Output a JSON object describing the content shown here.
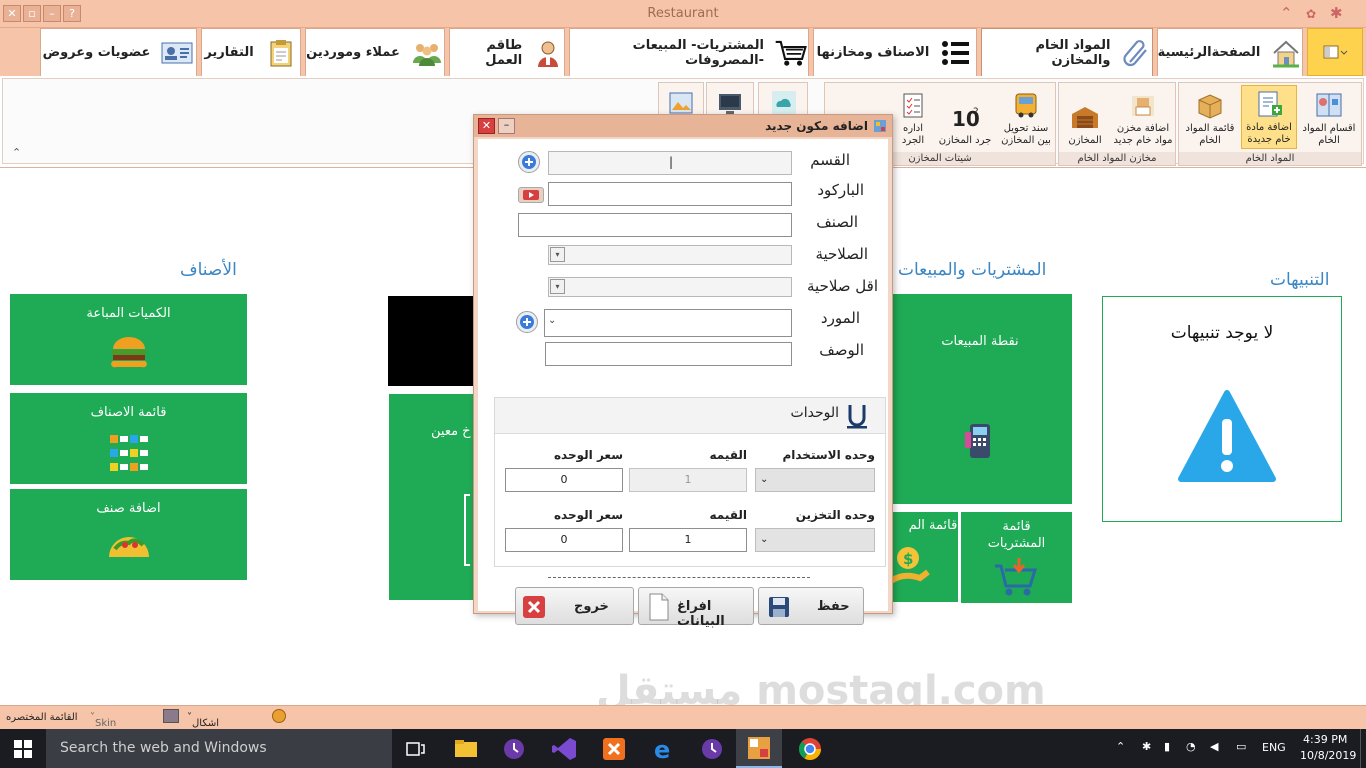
{
  "window": {
    "title": "Restaurant"
  },
  "tabs": [
    {
      "key": "home",
      "label": "الصفحةالرئيسية"
    },
    {
      "key": "raw",
      "label": "المواد الخام والمخازن"
    },
    {
      "key": "items",
      "label": "الاصناف ومخازنها"
    },
    {
      "key": "purchases",
      "label": "المشتريات- المبيعات -المصروفات"
    },
    {
      "key": "staff",
      "label": "طاقم العمل"
    },
    {
      "key": "clients",
      "label": "عملاء وموردين"
    },
    {
      "key": "reports",
      "label": "التقارير"
    },
    {
      "key": "members",
      "label": "عضويات وعروض"
    }
  ],
  "ribbon": {
    "groups": {
      "raw_materials": "المواد الخام",
      "raw_stores": "مخازن المواد الخام",
      "stock_sheets": "شيتات المخازن"
    },
    "buttons": {
      "raw_sections": "اقسام المواد الخام",
      "add_raw": "اضافة مادة خام جديدة",
      "raw_list": "قائمة المواد الخام",
      "add_store": "اضافة مخزن مواد خام جديد",
      "stores": "المخازن",
      "transfer": "سند تحويل بين المخازن",
      "inventory": "جرد المخازن",
      "manage_inventory": "اداره الجرد"
    }
  },
  "sections": {
    "alerts": "التنبيهات",
    "sales": "المشتريات والمبيعات",
    "items": "الأصناف"
  },
  "alerts": {
    "message": "لا يوجد تنبيهات"
  },
  "tiles": {
    "sold_qty": "الكميات المباعة",
    "items_list": "قائمة الاصناف",
    "add_item": "اضافة صنف",
    "pos": "نقطة المبيعات",
    "purchases_list": "قائمة المشتريات",
    "partial_list": "قائمة الم",
    "date_partial": "خ معين"
  },
  "dialog": {
    "title": "اضافه مكون جديد",
    "fields": {
      "section": "القسم",
      "barcode": "الباركود",
      "category": "الصنف",
      "validity": "الصلاحية",
      "min_validity": "اقل صلاحية",
      "supplier": "المورد",
      "description": "الوصف"
    },
    "units": {
      "title": "الوحدات",
      "usage_unit": "وحده الاستخدام",
      "value": "القيمه",
      "unit_price": "سعر الوحده",
      "storage_unit": "وحده التخزين",
      "usage_value": "1",
      "usage_price": "0",
      "storage_value": "1",
      "storage_price": "0"
    },
    "buttons": {
      "save": "حفظ",
      "clear": "افراغ البيانات",
      "exit": "خروج"
    }
  },
  "statusbar": {
    "quick_list": "القائمة المختصره",
    "skin_palette": "Skin Palette",
    "program_skins": "اشكال البرنامج"
  },
  "taskbar": {
    "search_placeholder": "Search the web and Windows",
    "language": "ENG",
    "time": "4:39 PM",
    "date": "10/8/2019"
  },
  "watermark": "مستقل mostaql.com",
  "colors": {
    "chrome": "#f6c4a8",
    "tile_green": "#1faa55",
    "section_blue": "#3a86c4",
    "active_quick_tab": "#ffd24d"
  }
}
